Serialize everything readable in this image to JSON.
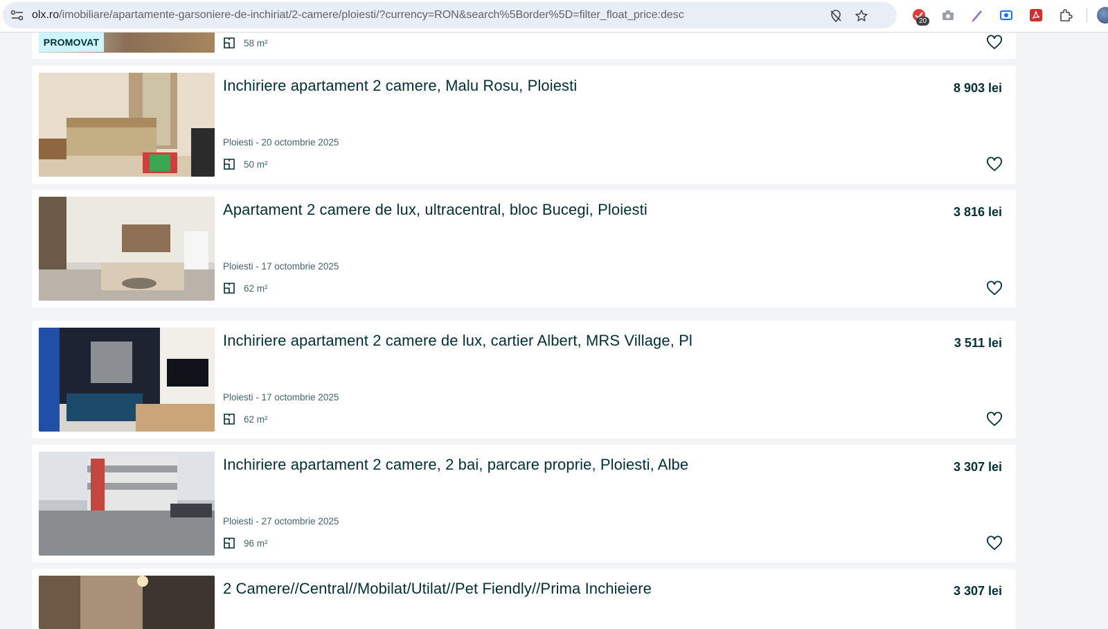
{
  "browser": {
    "url_host": "olx.ro",
    "url_path": "/imobiliare/apartamente-garsoniere-de-inchiriat/2-camere/ploiesti/?currency=RON&search%5Border%5D=filter_float_price:desc",
    "extension_badge": "20"
  },
  "top_partial": {
    "promo_label": "PROMOVAT",
    "area": "58 m²"
  },
  "listings": [
    {
      "title": "Inchiriere apartament 2 camere, Malu Rosu, Ploiesti",
      "price": "8 903 lei",
      "location_date": "Ploiesti - 20 octombrie 2025",
      "area": "50 m²"
    },
    {
      "title": "Apartament 2 camere de lux, ultracentral, bloc Bucegi, Ploiesti",
      "price": "3 816 lei",
      "location_date": "Ploiesti - 17 octombrie 2025",
      "area": "62 m²"
    },
    {
      "title": "Inchiriere apartament 2 camere de lux, cartier Albert, MRS Village, Pl",
      "price": "3 511 lei",
      "location_date": "Ploiesti - 17 octombrie 2025",
      "area": "62 m²"
    },
    {
      "title": "Inchiriere apartament 2 camere, 2 bai, parcare proprie, Ploiesti, Albe",
      "price": "3 307 lei",
      "location_date": "Ploiesti - 27 octombrie 2025",
      "area": "96 m²"
    },
    {
      "title": "2 Camere//Central//Mobilat/Utilat//Pet Fiendly//Prima Inchieiere",
      "price": "3 307 lei"
    }
  ],
  "colors": {
    "page_bg": "#f2f4f5",
    "text": "#002f34",
    "promo_bg": "#cef5fb"
  }
}
